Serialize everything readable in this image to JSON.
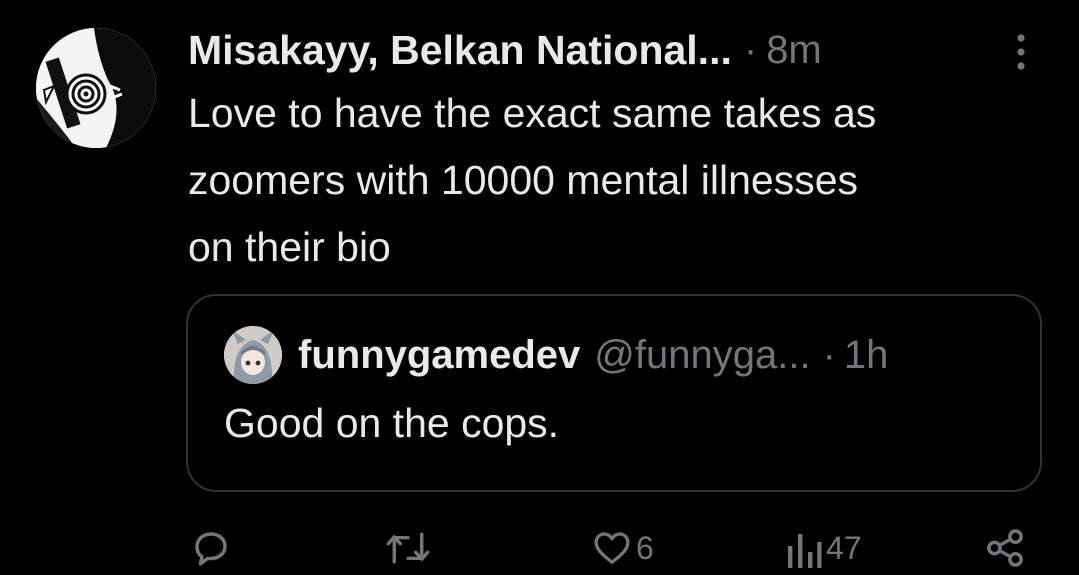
{
  "post": {
    "author_name": "Misakayy, Belkan National...",
    "separator": "·",
    "timestamp": "8m",
    "text": "Love to have the exact same takes as\nzoomers with 10000 mental illnesses\non their bio"
  },
  "quote": {
    "author_name": "funnygamedev",
    "handle": "@funnyga...",
    "separator": "·",
    "timestamp": "1h",
    "text": "Good on the cops."
  },
  "actions": {
    "reply_icon": "reply-icon",
    "repost_icon": "repost-icon",
    "like_icon": "heart-icon",
    "like_count": "6",
    "views_icon": "views-bar-chart-icon",
    "views_count": "47",
    "share_icon": "share-icon"
  },
  "colors": {
    "background": "#000000",
    "primary_text": "#e7e9ea",
    "secondary_text": "#71767b",
    "border": "#2f3336"
  }
}
